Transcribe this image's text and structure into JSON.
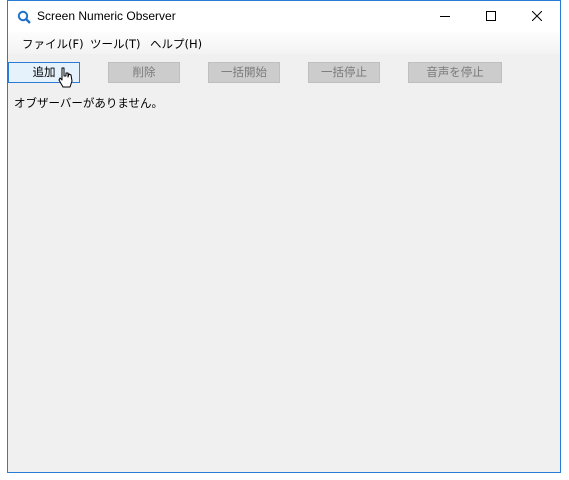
{
  "window": {
    "title": "Screen Numeric Observer",
    "icons": {
      "app": "magnifier-icon",
      "minimize": "minimize-icon",
      "maximize": "maximize-icon",
      "close": "close-icon"
    },
    "accent_color": "#2a7bd3"
  },
  "menu": {
    "items": [
      {
        "label": "ファイル(F)"
      },
      {
        "label": "ツール(T)"
      },
      {
        "label": "ヘルプ(H)"
      }
    ]
  },
  "toolbar": {
    "add_label": "追加",
    "delete_label": "削除",
    "start_all_label": "一括開始",
    "stop_all_label": "一括停止",
    "stop_sound_label": "音声を停止"
  },
  "content": {
    "empty_message": "オブザーバーがありません。"
  }
}
